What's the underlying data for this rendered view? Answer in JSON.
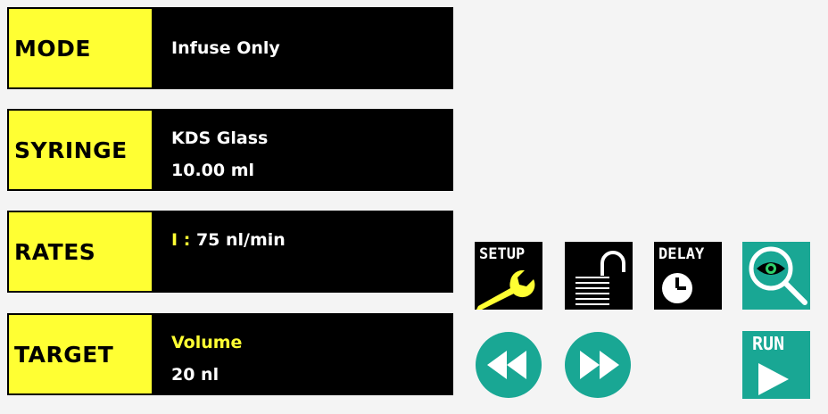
{
  "rows": {
    "mode": {
      "label": "MODE",
      "value": "Infuse Only"
    },
    "syringe": {
      "label": "SYRINGE",
      "line1": "KDS Glass",
      "line2": "10.00 ml"
    },
    "rates": {
      "label": "RATES",
      "prefix": "I",
      "separator": ":",
      "value": "75 nl/min"
    },
    "target": {
      "label": "TARGET",
      "line1": "Volume",
      "line2": "20 nl"
    }
  },
  "buttons": {
    "setup": {
      "label": "SETUP",
      "icon": "wrench-icon"
    },
    "lock": {
      "icon": "unlock-icon"
    },
    "delay": {
      "label": "DELAY",
      "icon": "clock-icon"
    },
    "view": {
      "icon": "eye-magnifier-icon"
    },
    "rewind": {
      "icon": "rewind-icon"
    },
    "fast_forward": {
      "icon": "fast-forward-icon"
    },
    "run": {
      "label": "RUN",
      "icon": "play-icon"
    }
  },
  "colors": {
    "label_bg": "#ffff33",
    "value_bg": "#000000",
    "accent_teal": "#19a794",
    "screen_bg": "#f4f4f4"
  }
}
